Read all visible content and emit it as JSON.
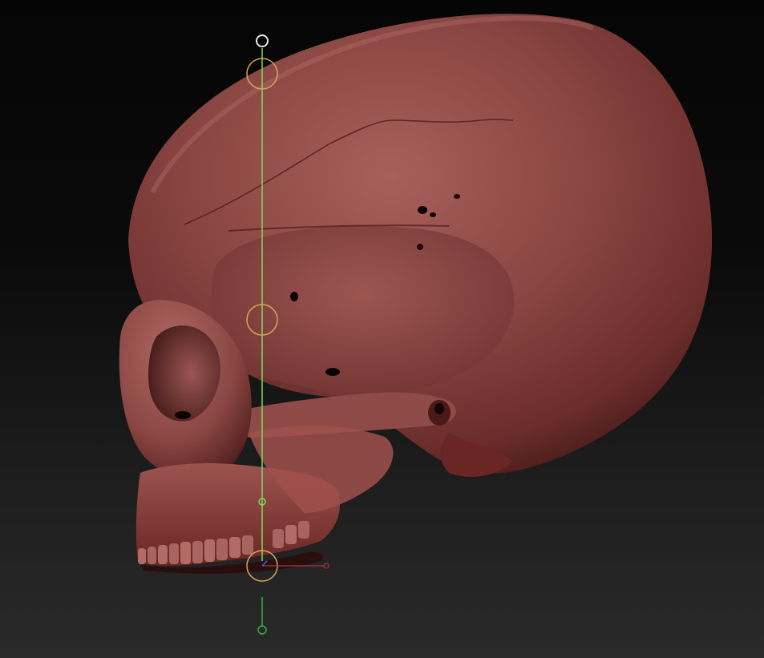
{
  "viewport": {
    "background_top": "#050505",
    "background_bottom": "#2a2a2a"
  },
  "model": {
    "name": "skull-model",
    "material_base": "#7a3a38",
    "material_highlight": "#a8605c",
    "material_shadow": "#3a1413"
  },
  "gizmo": {
    "type": "transpose-line",
    "line_color": "#7fdc5a",
    "ring_color": "#d8a25a",
    "top_handle_color": "#e6e6e6",
    "end_handle_color": "#3fae3a",
    "axis_x_color": "#a23a3a",
    "axis_z_color": "#3a4ad0"
  }
}
